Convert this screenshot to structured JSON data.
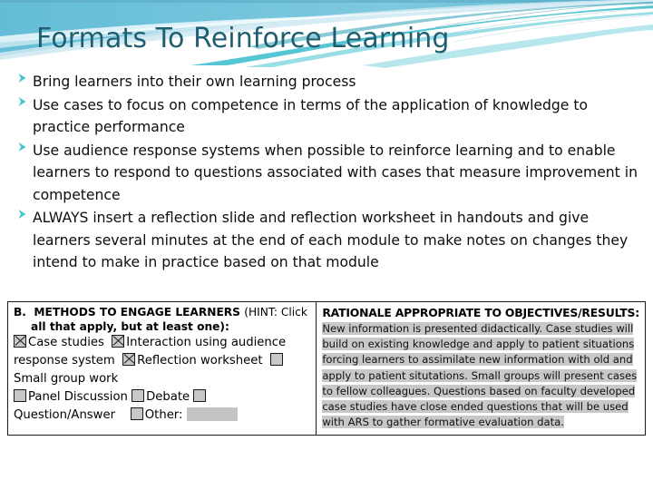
{
  "slide": {
    "title": "Formats To Reinforce Learning",
    "title_color": "#1f5f71",
    "background_color": "#ffffff",
    "banner_colors": {
      "sky_top": "#6cc0d8",
      "sky_bottom": "#a9dcea",
      "wave_teal": "#3fbfcf",
      "wave_light": "#bfe6ef",
      "wave_white": "#ffffff"
    },
    "bullet_marker_color": "#3fc9cf",
    "bullet_marker_name": "arrowhead-bullet"
  },
  "bullets": [
    "Bring learners into their own learning process",
    "Use cases to focus on competence in terms of the application of knowledge to practice performance",
    "Use audience response systems when possible to reinforce learning and to enable learners to respond to questions associated with cases that measure improvement in competence",
    "ALWAYS insert  a reflection slide and reflection worksheet in handouts and give learners several minutes at the end of each module to make notes on changes they intend to make in practice based on that module"
  ],
  "form": {
    "methods": {
      "label_prefix": "B.",
      "heading": "METHODS TO ENGAGE LEARNERS",
      "hint": "(HINT: Click",
      "hint_line2": "all that apply, but at least one):",
      "options": [
        {
          "label": "Case studies",
          "checked": true
        },
        {
          "label": "Interaction using audience response system",
          "checked": true
        },
        {
          "label": "Reflection worksheet",
          "checked": true
        },
        {
          "label": "Small group work",
          "checked": false
        },
        {
          "label": "Panel Discussion",
          "checked": false
        },
        {
          "label": "Debate",
          "checked": false
        },
        {
          "label": "Question/Answer",
          "checked": false
        },
        {
          "label": "Other:",
          "checked": false
        }
      ]
    },
    "rationale": {
      "heading": "RATIONALE APPROPRIATE TO OBJECTIVES/RESULTS:",
      "lines": [
        "New information is presented didactically. Case studies will",
        "build on existing knowledge and apply to patient situations",
        "forcing learners to assimilate  new information with old and",
        "apply to patient situtations.  Small groups will present cases",
        "to fellow colleagues. Questions based on faculty developed",
        "case studies have close ended questions that will be used",
        "with ARS to gather formative evaluation data."
      ]
    }
  }
}
